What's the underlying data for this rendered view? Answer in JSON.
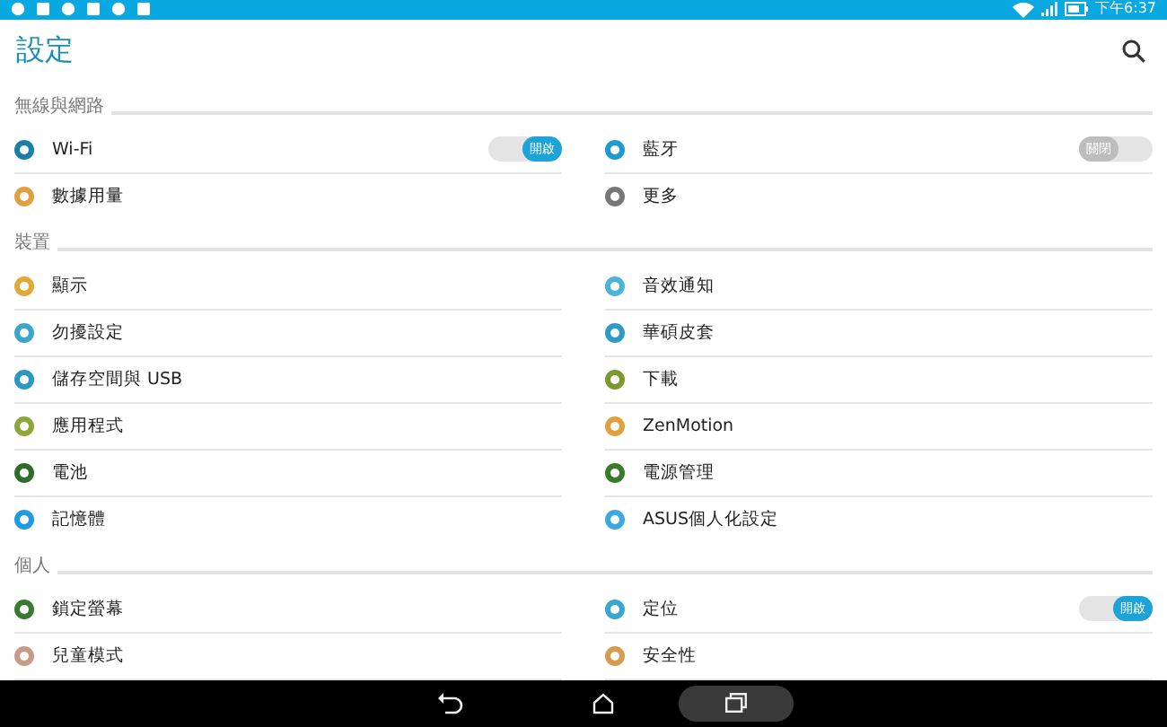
{
  "status_bar": {
    "time": "下午6:37"
  },
  "header": {
    "title": "設定"
  },
  "sections": [
    {
      "title": "無線與網路",
      "items": [
        {
          "label": "Wi-Fi",
          "kind": "toggle",
          "on": true,
          "switch_label": "開啟",
          "color": "#1a7fa8"
        },
        {
          "label": "藍牙",
          "kind": "toggle",
          "on": false,
          "switch_label": "關閉",
          "color": "#1e9ad0"
        },
        {
          "label": "數據用量",
          "kind": "plain",
          "color": "#e0a040"
        },
        {
          "label": "更多",
          "kind": "plain",
          "color": "#777777"
        }
      ]
    },
    {
      "title": "裝置",
      "items": [
        {
          "label": "顯示",
          "kind": "plain",
          "color": "#e3a83a"
        },
        {
          "label": "音效通知",
          "kind": "plain",
          "color": "#4fb3d9"
        },
        {
          "label": "勿擾設定",
          "kind": "plain",
          "color": "#3aa6cc"
        },
        {
          "label": "華碩皮套",
          "kind": "plain",
          "color": "#2e9bc6"
        },
        {
          "label": "儲存空間與 USB",
          "kind": "plain",
          "color": "#2b97c4"
        },
        {
          "label": "下載",
          "kind": "plain",
          "color": "#7a9a2e"
        },
        {
          "label": "應用程式",
          "kind": "plain",
          "color": "#8ca63a"
        },
        {
          "label": "ZenMotion",
          "kind": "plain",
          "color": "#e0a040"
        },
        {
          "label": "電池",
          "kind": "plain",
          "color": "#2f6b2a"
        },
        {
          "label": "電源管理",
          "kind": "plain",
          "color": "#3b7a2a"
        },
        {
          "label": "記憶體",
          "kind": "plain",
          "color": "#1f9be0"
        },
        {
          "label": "ASUS個人化設定",
          "kind": "plain",
          "color": "#3aa9e0"
        }
      ]
    },
    {
      "title": "個人",
      "items": [
        {
          "label": "鎖定螢幕",
          "kind": "plain",
          "color": "#3a7a30"
        },
        {
          "label": "定位",
          "kind": "toggle",
          "on": true,
          "switch_label": "開啟",
          "color": "#3aa6d0"
        },
        {
          "label": "兒童模式",
          "kind": "plain",
          "color": "#c89a8a"
        },
        {
          "label": "安全性",
          "kind": "plain",
          "color": "#d69a50"
        }
      ]
    }
  ]
}
